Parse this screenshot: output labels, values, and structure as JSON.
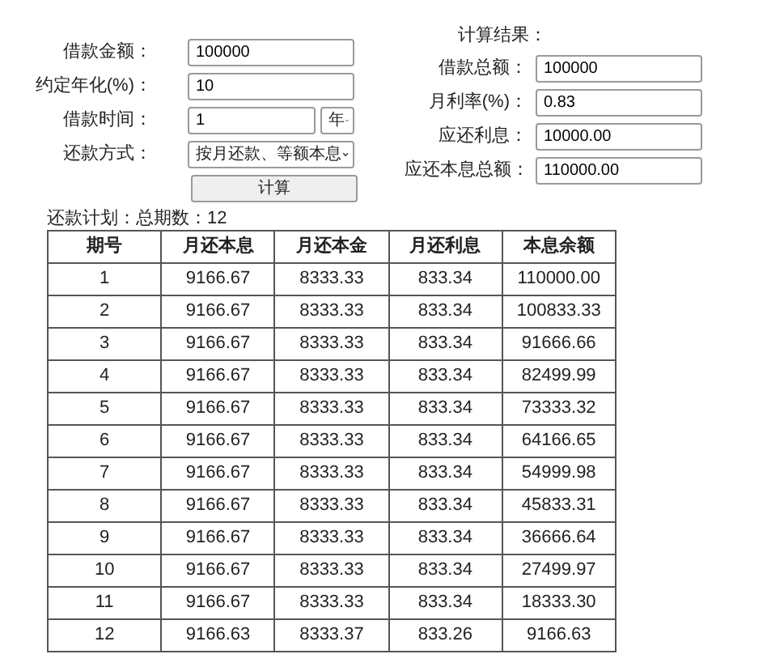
{
  "loan_form": {
    "fields": [
      {
        "kind": "input",
        "label": "借款金额：",
        "value": "100000"
      },
      {
        "kind": "input",
        "label": "约定年化(%)：",
        "value": "10"
      },
      {
        "kind": "input_unit",
        "label": "借款时间：",
        "value": "1",
        "unit": "年"
      },
      {
        "kind": "select",
        "label": "还款方式：",
        "value": "按月还款、等额本息"
      }
    ],
    "button": "计算"
  },
  "results": {
    "title": "计算结果：",
    "fields": [
      {
        "label": "借款总额：",
        "value": "100000"
      },
      {
        "label": "月利率(%)：",
        "value": "0.83"
      },
      {
        "label": "应还利息：",
        "value": "10000.00"
      },
      {
        "label": "应还本息总额：",
        "value": "110000.00"
      }
    ]
  },
  "plan": {
    "title": "还款计划：总期数：12",
    "table": {
      "columns": [
        "期号",
        "月还本息",
        "月还本金",
        "月还利息",
        "本息余额"
      ],
      "rows": [
        [
          "1",
          "9166.67",
          "8333.33",
          "833.34",
          "110000.00"
        ],
        [
          "2",
          "9166.67",
          "8333.33",
          "833.34",
          "100833.33"
        ],
        [
          "3",
          "9166.67",
          "8333.33",
          "833.34",
          "91666.66"
        ],
        [
          "4",
          "9166.67",
          "8333.33",
          "833.34",
          "82499.99"
        ],
        [
          "5",
          "9166.67",
          "8333.33",
          "833.34",
          "73333.32"
        ],
        [
          "6",
          "9166.67",
          "8333.33",
          "833.34",
          "64166.65"
        ],
        [
          "7",
          "9166.67",
          "8333.33",
          "833.34",
          "54999.98"
        ],
        [
          "8",
          "9166.67",
          "8333.33",
          "833.34",
          "45833.31"
        ],
        [
          "9",
          "9166.67",
          "8333.33",
          "833.34",
          "36666.64"
        ],
        [
          "10",
          "9166.67",
          "8333.33",
          "833.34",
          "27499.97"
        ],
        [
          "11",
          "9166.67",
          "8333.33",
          "833.34",
          "18333.30"
        ],
        [
          "12",
          "9166.63",
          "8333.37",
          "833.26",
          "9166.63"
        ]
      ]
    }
  }
}
